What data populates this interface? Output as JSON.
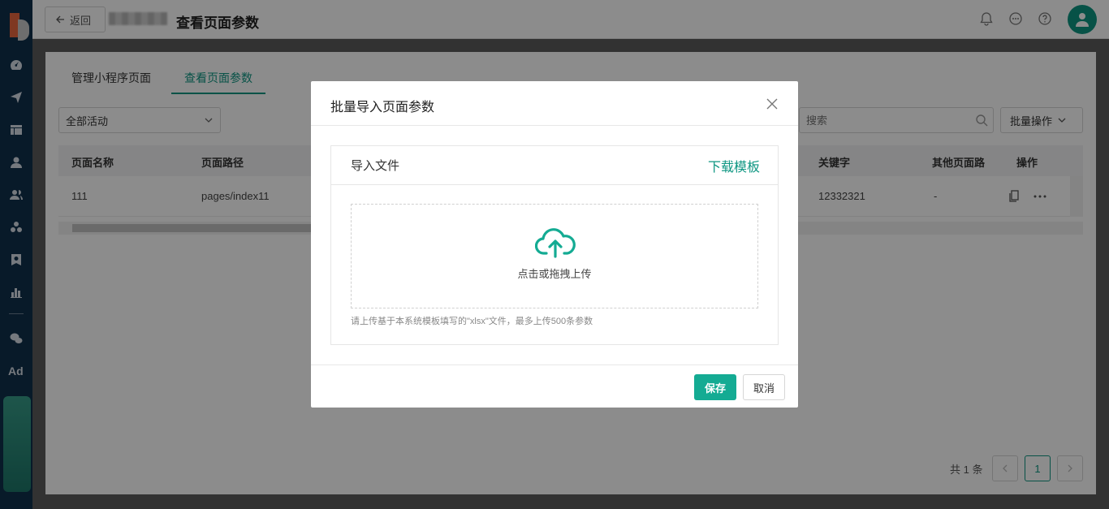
{
  "sidebar": {
    "ad_label": "Ad"
  },
  "header": {
    "back_label": "返回",
    "title": "查看页面参数"
  },
  "tabs": [
    "管理小程序页面",
    "查看页面参数"
  ],
  "filter": {
    "selected": "全部活动"
  },
  "search": {
    "placeholder": "搜索"
  },
  "batch": {
    "label": "批量操作"
  },
  "table": {
    "columns": [
      "页面名称",
      "页面路径",
      "关键字",
      "其他页面路",
      "操作"
    ],
    "rows": [
      {
        "name": "111",
        "path": "pages/index11",
        "keyword": "12332321",
        "other": "-"
      }
    ]
  },
  "pagination": {
    "total": "共 1 条",
    "current": "1"
  },
  "modal": {
    "title": "批量导入页面参数",
    "panel_title": "导入文件",
    "download_link": "下载模板",
    "drop_text": "点击或拖拽上传",
    "hint": "请上传基于本系统模板填写的\"xlsx\"文件，最多上传500条参数",
    "save": "保存",
    "cancel": "取消"
  },
  "colors": {
    "accent": "#0e9682",
    "primary_button": "#14ab93",
    "sidebar": "#10304c"
  }
}
